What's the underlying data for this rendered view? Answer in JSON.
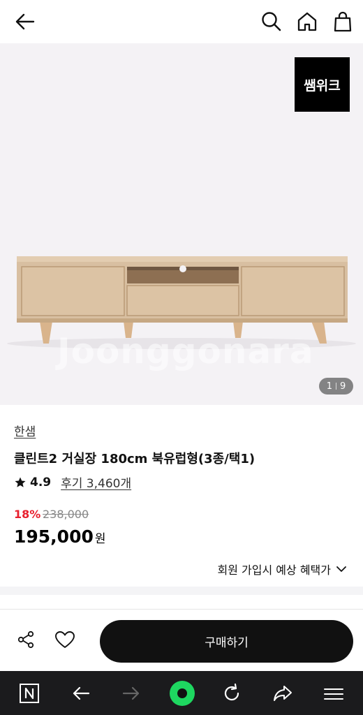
{
  "header": {
    "icons": [
      "back-arrow-icon",
      "search-icon",
      "home-icon",
      "shopping-bag-icon"
    ]
  },
  "hero": {
    "brand_badge": "쌤위크",
    "watermark": "Joonggonara",
    "image_counter": {
      "current": "1",
      "total": "9"
    }
  },
  "product": {
    "seller": "한샘",
    "title": "클린트2 거실장 180cm 북유럽형(3종/택1)",
    "rating": "4.9",
    "reviews": "후기 3,460개",
    "discount": "18%",
    "original_price": "238,000",
    "price": "195,000",
    "price_unit": "원",
    "benefit": "회원 가입시 예상 혜택가"
  },
  "actions": {
    "buy_label": "구매하기"
  },
  "colors": {
    "discount": "#e8202e",
    "hero_bg": "#f4f2f5",
    "buy_button": "#111111",
    "browser_bar": "#1b1b1d",
    "browser_home": "#1ed760"
  }
}
